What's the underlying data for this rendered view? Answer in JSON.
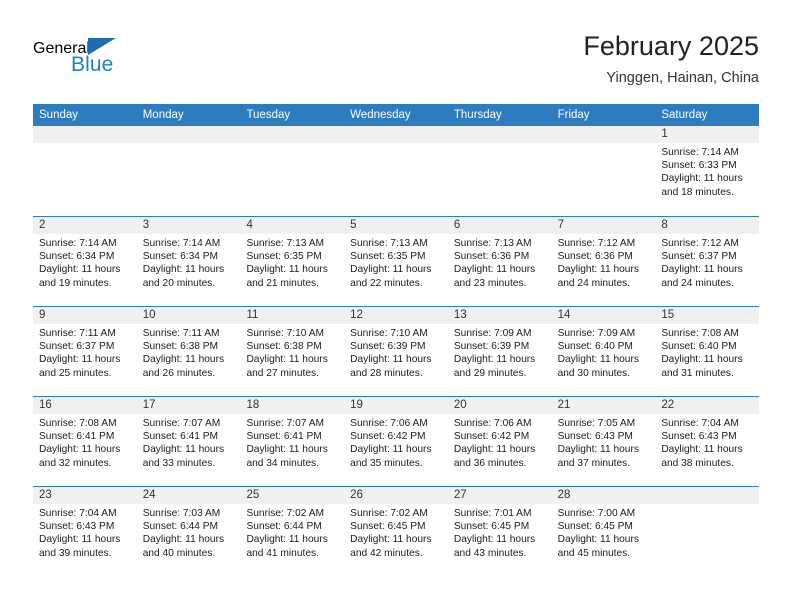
{
  "brand": {
    "word_one": "General",
    "word_two": "Blue",
    "flag_icon": "blue-triangle-flag-icon"
  },
  "header": {
    "title": "February 2025",
    "location": "Yinggen, Hainan, China"
  },
  "colors": {
    "header_blue": "#2e7cc0",
    "brand_blue": "#1b7fd4",
    "daynum_band": "#f0f0f0",
    "text": "#1c1c1c"
  },
  "weekdays": [
    "Sunday",
    "Monday",
    "Tuesday",
    "Wednesday",
    "Thursday",
    "Friday",
    "Saturday"
  ],
  "weeks": [
    [
      {
        "day": "",
        "lines": []
      },
      {
        "day": "",
        "lines": []
      },
      {
        "day": "",
        "lines": []
      },
      {
        "day": "",
        "lines": []
      },
      {
        "day": "",
        "lines": []
      },
      {
        "day": "",
        "lines": []
      },
      {
        "day": "1",
        "lines": [
          "Sunrise: 7:14 AM",
          "Sunset: 6:33 PM",
          "Daylight: 11 hours",
          "and 18 minutes."
        ]
      }
    ],
    [
      {
        "day": "2",
        "lines": [
          "Sunrise: 7:14 AM",
          "Sunset: 6:34 PM",
          "Daylight: 11 hours",
          "and 19 minutes."
        ]
      },
      {
        "day": "3",
        "lines": [
          "Sunrise: 7:14 AM",
          "Sunset: 6:34 PM",
          "Daylight: 11 hours",
          "and 20 minutes."
        ]
      },
      {
        "day": "4",
        "lines": [
          "Sunrise: 7:13 AM",
          "Sunset: 6:35 PM",
          "Daylight: 11 hours",
          "and 21 minutes."
        ]
      },
      {
        "day": "5",
        "lines": [
          "Sunrise: 7:13 AM",
          "Sunset: 6:35 PM",
          "Daylight: 11 hours",
          "and 22 minutes."
        ]
      },
      {
        "day": "6",
        "lines": [
          "Sunrise: 7:13 AM",
          "Sunset: 6:36 PM",
          "Daylight: 11 hours",
          "and 23 minutes."
        ]
      },
      {
        "day": "7",
        "lines": [
          "Sunrise: 7:12 AM",
          "Sunset: 6:36 PM",
          "Daylight: 11 hours",
          "and 24 minutes."
        ]
      },
      {
        "day": "8",
        "lines": [
          "Sunrise: 7:12 AM",
          "Sunset: 6:37 PM",
          "Daylight: 11 hours",
          "and 24 minutes."
        ]
      }
    ],
    [
      {
        "day": "9",
        "lines": [
          "Sunrise: 7:11 AM",
          "Sunset: 6:37 PM",
          "Daylight: 11 hours",
          "and 25 minutes."
        ]
      },
      {
        "day": "10",
        "lines": [
          "Sunrise: 7:11 AM",
          "Sunset: 6:38 PM",
          "Daylight: 11 hours",
          "and 26 minutes."
        ]
      },
      {
        "day": "11",
        "lines": [
          "Sunrise: 7:10 AM",
          "Sunset: 6:38 PM",
          "Daylight: 11 hours",
          "and 27 minutes."
        ]
      },
      {
        "day": "12",
        "lines": [
          "Sunrise: 7:10 AM",
          "Sunset: 6:39 PM",
          "Daylight: 11 hours",
          "and 28 minutes."
        ]
      },
      {
        "day": "13",
        "lines": [
          "Sunrise: 7:09 AM",
          "Sunset: 6:39 PM",
          "Daylight: 11 hours",
          "and 29 minutes."
        ]
      },
      {
        "day": "14",
        "lines": [
          "Sunrise: 7:09 AM",
          "Sunset: 6:40 PM",
          "Daylight: 11 hours",
          "and 30 minutes."
        ]
      },
      {
        "day": "15",
        "lines": [
          "Sunrise: 7:08 AM",
          "Sunset: 6:40 PM",
          "Daylight: 11 hours",
          "and 31 minutes."
        ]
      }
    ],
    [
      {
        "day": "16",
        "lines": [
          "Sunrise: 7:08 AM",
          "Sunset: 6:41 PM",
          "Daylight: 11 hours",
          "and 32 minutes."
        ]
      },
      {
        "day": "17",
        "lines": [
          "Sunrise: 7:07 AM",
          "Sunset: 6:41 PM",
          "Daylight: 11 hours",
          "and 33 minutes."
        ]
      },
      {
        "day": "18",
        "lines": [
          "Sunrise: 7:07 AM",
          "Sunset: 6:41 PM",
          "Daylight: 11 hours",
          "and 34 minutes."
        ]
      },
      {
        "day": "19",
        "lines": [
          "Sunrise: 7:06 AM",
          "Sunset: 6:42 PM",
          "Daylight: 11 hours",
          "and 35 minutes."
        ]
      },
      {
        "day": "20",
        "lines": [
          "Sunrise: 7:06 AM",
          "Sunset: 6:42 PM",
          "Daylight: 11 hours",
          "and 36 minutes."
        ]
      },
      {
        "day": "21",
        "lines": [
          "Sunrise: 7:05 AM",
          "Sunset: 6:43 PM",
          "Daylight: 11 hours",
          "and 37 minutes."
        ]
      },
      {
        "day": "22",
        "lines": [
          "Sunrise: 7:04 AM",
          "Sunset: 6:43 PM",
          "Daylight: 11 hours",
          "and 38 minutes."
        ]
      }
    ],
    [
      {
        "day": "23",
        "lines": [
          "Sunrise: 7:04 AM",
          "Sunset: 6:43 PM",
          "Daylight: 11 hours",
          "and 39 minutes."
        ]
      },
      {
        "day": "24",
        "lines": [
          "Sunrise: 7:03 AM",
          "Sunset: 6:44 PM",
          "Daylight: 11 hours",
          "and 40 minutes."
        ]
      },
      {
        "day": "25",
        "lines": [
          "Sunrise: 7:02 AM",
          "Sunset: 6:44 PM",
          "Daylight: 11 hours",
          "and 41 minutes."
        ]
      },
      {
        "day": "26",
        "lines": [
          "Sunrise: 7:02 AM",
          "Sunset: 6:45 PM",
          "Daylight: 11 hours",
          "and 42 minutes."
        ]
      },
      {
        "day": "27",
        "lines": [
          "Sunrise: 7:01 AM",
          "Sunset: 6:45 PM",
          "Daylight: 11 hours",
          "and 43 minutes."
        ]
      },
      {
        "day": "28",
        "lines": [
          "Sunrise: 7:00 AM",
          "Sunset: 6:45 PM",
          "Daylight: 11 hours",
          "and 45 minutes."
        ]
      },
      {
        "day": "",
        "lines": []
      }
    ]
  ]
}
